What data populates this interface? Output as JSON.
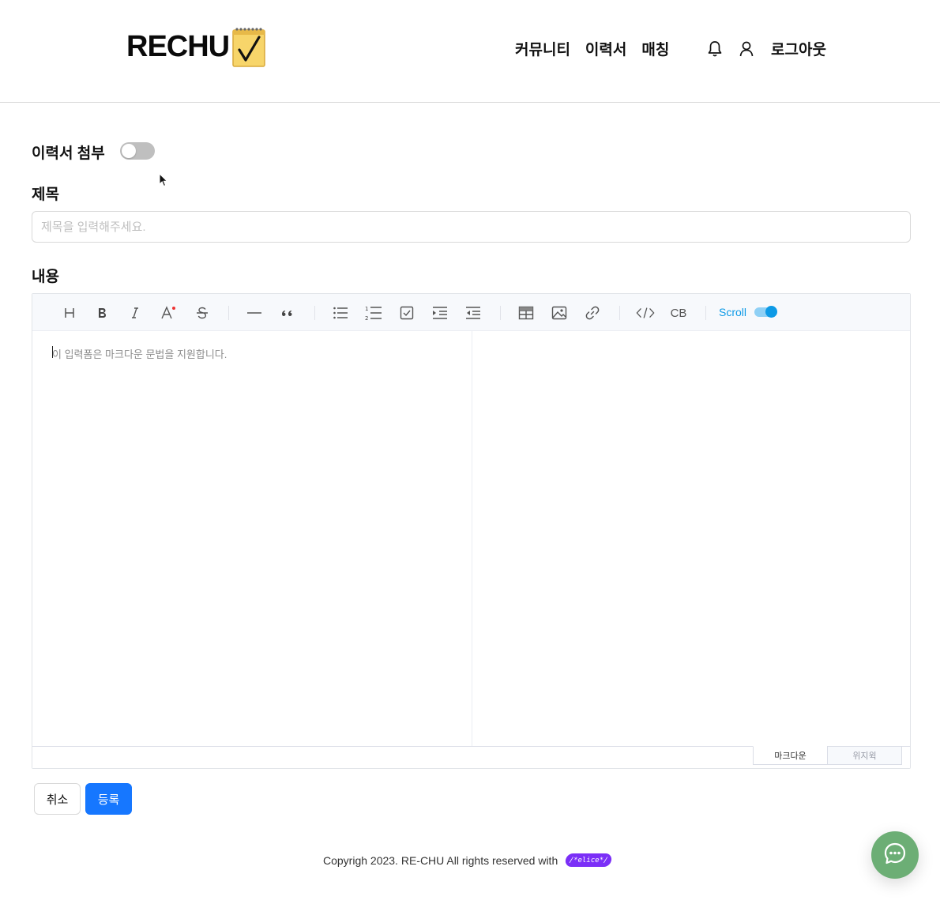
{
  "header": {
    "logo_text": "RECHU",
    "logo_icon": "notepad-check-icon",
    "nav": [
      "커뮤니티",
      "이력서",
      "매칭"
    ],
    "icons": [
      "bell-icon",
      "user-icon"
    ],
    "logout_label": "로그아웃"
  },
  "form": {
    "resume_attach_label": "이력서 첨부",
    "resume_attach_on": false,
    "title_label": "제목",
    "title_placeholder": "제목을 입력해주세요.",
    "title_value": "",
    "content_label": "내용"
  },
  "editor": {
    "toolbar_icons": [
      "heading-icon",
      "bold-icon",
      "italic-icon",
      "text-color-icon",
      "strike-icon",
      "horizontal-rule-icon",
      "quote-icon",
      "bullet-list-icon",
      "ordered-list-icon",
      "task-list-icon",
      "indent-icon",
      "outdent-icon",
      "table-icon",
      "image-icon",
      "link-icon",
      "code-icon",
      "codeblock-icon"
    ],
    "codeblock_label": "CB",
    "scroll_label": "Scroll",
    "scroll_sync_on": true,
    "placeholder": "이 입력폼은 마크다운 문법을 지원합니다.",
    "mode_tabs": {
      "markdown": "마크다운",
      "wysiwyg": "위지윅"
    },
    "active_mode": "마크다운",
    "accent_color": "#0d9ae6"
  },
  "buttons": {
    "cancel": "취소",
    "submit": "등록",
    "submit_color": "#1677ff"
  },
  "footer": {
    "copyright": "Copyrigh 2023. RE-CHU All rights reserved with",
    "brand_badge": "/*elice*/"
  },
  "chat": {
    "icon": "chat-bubble-icon",
    "color": "#6cae75"
  }
}
